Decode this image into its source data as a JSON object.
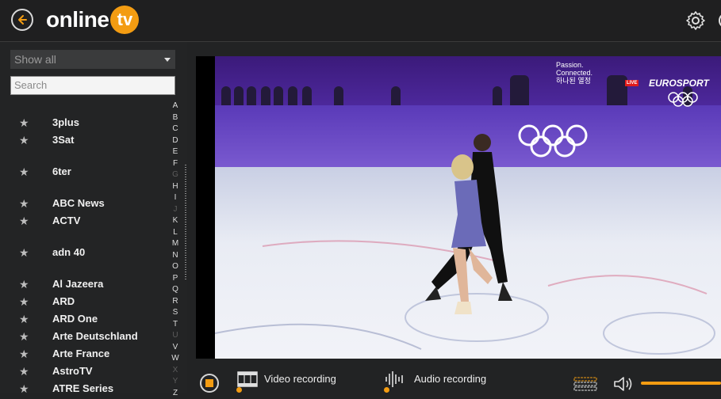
{
  "header": {
    "logo_text": "online",
    "logo_badge": "tv"
  },
  "sidebar": {
    "filter_value": "Show all",
    "search_placeholder": "Search",
    "channels": [
      {
        "name": "3plus"
      },
      {
        "name": "3Sat"
      },
      {
        "name": "6ter"
      },
      {
        "name": "ABC News"
      },
      {
        "name": "ACTV"
      },
      {
        "name": "adn 40"
      },
      {
        "name": "Al Jazeera"
      },
      {
        "name": "ARD"
      },
      {
        "name": "ARD One"
      },
      {
        "name": "Arte Deutschland"
      },
      {
        "name": "Arte France"
      },
      {
        "name": "AstroTV"
      },
      {
        "name": "ATRE Series"
      }
    ],
    "alphabet": [
      "A",
      "B",
      "C",
      "D",
      "E",
      "F",
      "G",
      "H",
      "I",
      "J",
      "K",
      "L",
      "M",
      "N",
      "O",
      "P",
      "Q",
      "R",
      "S",
      "T",
      "U",
      "V",
      "W",
      "X",
      "Y",
      "Z"
    ],
    "alphabet_dim": [
      "G",
      "J",
      "U",
      "X",
      "Y"
    ]
  },
  "video": {
    "sponsor_line1": "Passion.",
    "sponsor_line2": "Connected.",
    "sponsor_line3": "하나된 열정",
    "live_badge": "LIVE",
    "channel_brand": "EUROSPORT"
  },
  "controls": {
    "video_recording_label": "Video recording",
    "audio_recording_label": "Audio recording",
    "volume_level": 1.0
  },
  "colors": {
    "accent": "#f39c12",
    "background": "#222324"
  }
}
